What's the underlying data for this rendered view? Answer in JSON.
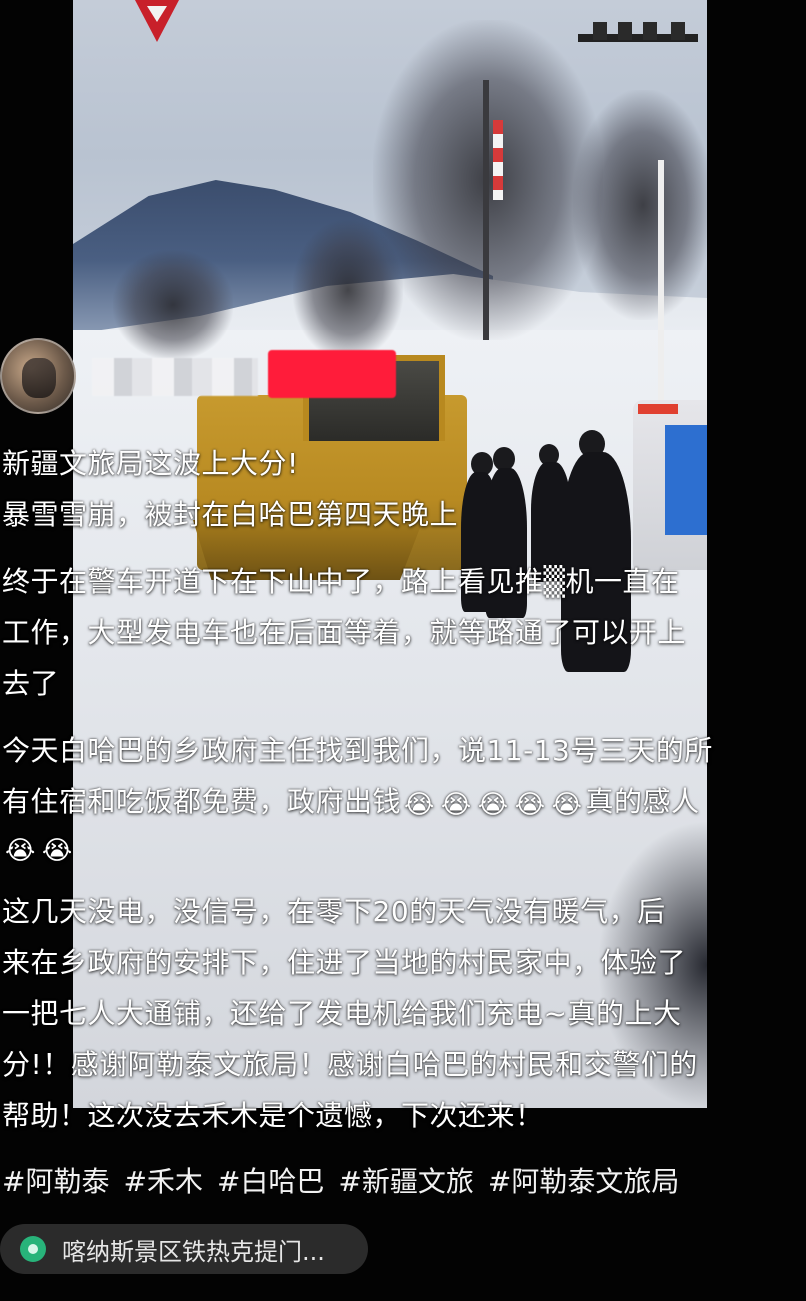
{
  "post": {
    "lines": {
      "l1": "新疆文旅局这波上大分!",
      "l2": "暴雪雪崩，被封在白哈巴第四天晚上",
      "l3": "终于在警车开道下在下山中了，路上看见推▒机一直在",
      "l4": "工作，大型发电车也在后面等着，就等路通了可以开上",
      "l5": "去了",
      "l6": "今天白哈巴的乡政府主任找到我们，说11-13号三天的所",
      "l7a": "有住宿和吃饭都免费，政府出钱",
      "l7b": "真的感人",
      "l9": "这几天没电，没信号，在零下20的天气没有暖气，后",
      "l10": "来在乡政府的安排下，住进了当地的村民家中，体验了",
      "l11": "一把七人大通铺，还给了发电机给我们充电~真的上大",
      "l12": "分!！感谢阿勒泰文旅局！感谢白哈巴的村民和交警们的",
      "l13": "帮助！这次没去禾木是个遗憾，下次还来！"
    },
    "emoji": "😭"
  },
  "tags": {
    "t1": "#阿勒泰",
    "t2": "#禾木",
    "t3": "#白哈巴",
    "t4": "#新疆文旅",
    "t5": "#阿勒泰文旅局"
  },
  "location": {
    "text": "喀纳斯景区铁热克提门..."
  },
  "colors": {
    "background": "#050505",
    "location_icon": "#28b37a",
    "redacted_badge": "#ff1c3a"
  }
}
